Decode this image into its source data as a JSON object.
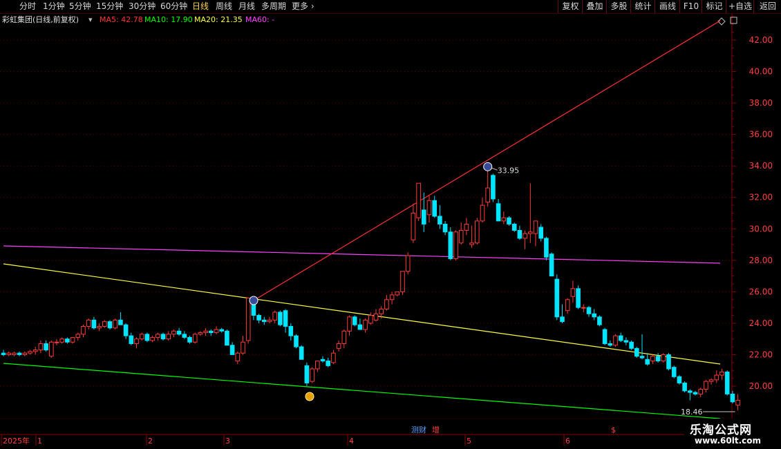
{
  "toolbar": {
    "periods": [
      "分时",
      "1分钟",
      "5分钟",
      "15分钟",
      "30分钟",
      "60分钟",
      "日线",
      "周线",
      "月线",
      "多周期",
      "更多"
    ],
    "active_period": "日线",
    "buttons": [
      "复权",
      "叠加",
      "多股",
      "统计",
      "画线",
      "F10",
      "标记",
      "+自选",
      "返回"
    ]
  },
  "legend": {
    "title": "彩虹集团(日线,前复权)",
    "ma5": "MA5: 42.78",
    "ma10": "MA10: 17.90",
    "ma20": "MA20: 21.35",
    "ma60": "MA60: -"
  },
  "colors": {
    "up": "#ff3b3b",
    "down": "#00e5ff",
    "ma5": "#ff3030",
    "ma10": "#00ff00",
    "ma20": "#ffff44",
    "ma60": "#ff40ff",
    "axis": "#8b0000",
    "grid": "#6b0000"
  },
  "chart_data": {
    "type": "candlestick",
    "ylim": [
      18.0,
      43.5
    ],
    "y_ticks": [
      20.0,
      22.0,
      24.0,
      26.0,
      28.0,
      30.0,
      32.0,
      34.0,
      36.0,
      38.0,
      40.0,
      42.0
    ],
    "x_labels": [
      "2025年",
      "1",
      "2",
      "3",
      "4",
      "5",
      "6"
    ],
    "high_label": "33.95",
    "low_label": "18.46",
    "event_markers": [
      "测财",
      "增",
      "$"
    ],
    "candles": [
      [
        22.1,
        22.3,
        21.9,
        22.0
      ],
      [
        22.0,
        22.2,
        21.9,
        22.1
      ],
      [
        22.0,
        22.2,
        21.9,
        22.1
      ],
      [
        22.1,
        22.2,
        21.9,
        22.0
      ],
      [
        22.0,
        22.2,
        21.9,
        22.1
      ],
      [
        22.1,
        22.3,
        22.0,
        22.2
      ],
      [
        22.2,
        22.5,
        22.0,
        22.3
      ],
      [
        22.3,
        22.9,
        22.1,
        22.7
      ],
      [
        22.7,
        22.9,
        22.2,
        22.3
      ],
      [
        21.9,
        22.9,
        21.8,
        22.8
      ],
      [
        22.8,
        23.0,
        22.6,
        22.8
      ],
      [
        22.8,
        23.1,
        22.7,
        23.0
      ],
      [
        23.0,
        23.1,
        22.7,
        22.8
      ],
      [
        22.8,
        23.1,
        22.7,
        23.1
      ],
      [
        23.1,
        23.4,
        22.9,
        23.3
      ],
      [
        23.3,
        23.9,
        23.1,
        23.8
      ],
      [
        23.8,
        24.3,
        23.6,
        24.2
      ],
      [
        24.2,
        24.4,
        23.6,
        23.7
      ],
      [
        23.7,
        24.0,
        23.5,
        23.8
      ],
      [
        23.8,
        24.2,
        23.7,
        24.1
      ],
      [
        24.1,
        24.2,
        23.6,
        23.7
      ],
      [
        23.7,
        24.3,
        23.6,
        24.2
      ],
      [
        24.2,
        24.7,
        23.9,
        23.9
      ],
      [
        23.9,
        24.0,
        23.0,
        23.2
      ],
      [
        23.2,
        23.4,
        22.6,
        22.7
      ],
      [
        22.7,
        23.1,
        22.4,
        23.0
      ],
      [
        23.0,
        23.4,
        22.9,
        23.3
      ],
      [
        23.3,
        23.4,
        22.8,
        22.9
      ],
      [
        22.9,
        23.2,
        22.8,
        23.1
      ],
      [
        23.1,
        23.4,
        22.9,
        23.3
      ],
      [
        23.3,
        23.4,
        22.9,
        23.0
      ],
      [
        23.0,
        23.5,
        22.9,
        23.3
      ],
      [
        23.3,
        23.6,
        23.1,
        23.5
      ],
      [
        23.5,
        23.7,
        23.2,
        23.3
      ],
      [
        23.3,
        23.5,
        23.0,
        23.1
      ],
      [
        23.1,
        23.2,
        22.7,
        22.8
      ],
      [
        22.8,
        23.4,
        22.7,
        23.3
      ],
      [
        23.3,
        23.5,
        23.2,
        23.4
      ],
      [
        23.4,
        23.7,
        23.2,
        23.5
      ],
      [
        23.5,
        23.6,
        23.2,
        23.4
      ],
      [
        23.4,
        23.8,
        23.3,
        23.6
      ],
      [
        23.6,
        23.7,
        23.4,
        23.5
      ],
      [
        23.5,
        23.6,
        22.6,
        22.6
      ],
      [
        22.6,
        22.8,
        22.0,
        22.0
      ],
      [
        21.6,
        22.2,
        21.4,
        22.1
      ],
      [
        22.1,
        23.2,
        22.0,
        22.8
      ],
      [
        22.9,
        25.6,
        22.7,
        25.6
      ],
      [
        25.3,
        25.6,
        24.2,
        24.5
      ],
      [
        24.5,
        24.6,
        24.0,
        24.2
      ],
      [
        24.2,
        24.4,
        23.9,
        24.1
      ],
      [
        24.1,
        24.4,
        24.0,
        24.2
      ],
      [
        24.2,
        24.8,
        24.0,
        24.7
      ],
      [
        24.7,
        24.8,
        23.8,
        23.9
      ],
      [
        24.8,
        24.9,
        23.4,
        23.8
      ],
      [
        23.8,
        24.0,
        22.9,
        23.2
      ],
      [
        23.2,
        23.3,
        22.4,
        22.5
      ],
      [
        22.5,
        22.6,
        21.7,
        21.7
      ],
      [
        21.3,
        21.5,
        20.0,
        20.2
      ],
      [
        20.3,
        21.2,
        20.2,
        21.1
      ],
      [
        21.1,
        21.6,
        20.9,
        21.6
      ],
      [
        21.7,
        21.9,
        21.5,
        21.6
      ],
      [
        21.6,
        21.8,
        21.2,
        21.3
      ],
      [
        21.5,
        22.3,
        21.4,
        22.1
      ],
      [
        22.4,
        22.9,
        22.2,
        22.7
      ],
      [
        22.7,
        23.6,
        22.4,
        23.5
      ],
      [
        23.5,
        24.5,
        23.2,
        24.4
      ],
      [
        24.4,
        24.5,
        23.8,
        23.9
      ],
      [
        23.9,
        24.3,
        23.6,
        23.6
      ],
      [
        23.6,
        24.3,
        23.4,
        24.2
      ],
      [
        24.0,
        24.7,
        23.9,
        24.5
      ],
      [
        24.2,
        24.9,
        24.1,
        24.6
      ],
      [
        24.6,
        25.1,
        24.3,
        24.9
      ],
      [
        24.9,
        25.8,
        24.8,
        25.5
      ],
      [
        25.5,
        26.0,
        25.2,
        25.8
      ],
      [
        25.8,
        26.0,
        25.7,
        26.0
      ],
      [
        26.0,
        27.3,
        25.8,
        27.3
      ],
      [
        27.3,
        28.5,
        27.1,
        28.3
      ],
      [
        29.3,
        31.6,
        29.1,
        31.0
      ],
      [
        30.7,
        32.9,
        30.5,
        32.9
      ],
      [
        31.2,
        32.3,
        29.8,
        30.3
      ],
      [
        30.9,
        32.1,
        30.4,
        31.8
      ],
      [
        31.8,
        32.1,
        30.7,
        30.8
      ],
      [
        30.8,
        31.5,
        30.0,
        30.3
      ],
      [
        30.3,
        30.5,
        29.6,
        29.8
      ],
      [
        29.8,
        30.1,
        28.0,
        28.1
      ],
      [
        28.1,
        29.9,
        28.0,
        29.8
      ],
      [
        29.1,
        30.4,
        29.0,
        29.9
      ],
      [
        29.9,
        30.7,
        29.6,
        30.3
      ],
      [
        29.0,
        30.2,
        28.8,
        29.1
      ],
      [
        29.1,
        30.7,
        29.0,
        30.5
      ],
      [
        30.5,
        32.0,
        30.4,
        31.5
      ],
      [
        31.7,
        33.95,
        31.4,
        32.6
      ],
      [
        33.4,
        33.5,
        31.7,
        31.9
      ],
      [
        31.6,
        31.9,
        30.5,
        30.5
      ],
      [
        30.5,
        31.1,
        30.3,
        30.7
      ],
      [
        30.7,
        30.8,
        30.2,
        30.3
      ],
      [
        30.3,
        30.4,
        29.8,
        29.9
      ],
      [
        29.9,
        30.2,
        29.3,
        29.4
      ],
      [
        29.4,
        29.9,
        28.7,
        29.7
      ],
      [
        29.7,
        32.9,
        29.1,
        29.8
      ],
      [
        29.7,
        30.5,
        28.9,
        30.5
      ],
      [
        30.1,
        30.3,
        29.2,
        29.4
      ],
      [
        29.4,
        29.5,
        28.0,
        28.2
      ],
      [
        28.4,
        28.5,
        27.0,
        27.0
      ],
      [
        26.8,
        27.1,
        24.2,
        24.4
      ],
      [
        24.4,
        25.2,
        24.0,
        24.1
      ],
      [
        24.8,
        25.6,
        24.6,
        25.5
      ],
      [
        25.7,
        26.7,
        25.3,
        26.2
      ],
      [
        26.2,
        26.4,
        24.9,
        25.0
      ],
      [
        25.0,
        25.2,
        24.7,
        25.0
      ],
      [
        25.0,
        25.1,
        24.4,
        24.6
      ],
      [
        24.6,
        24.9,
        24.2,
        24.4
      ],
      [
        24.4,
        24.5,
        23.8,
        23.9
      ],
      [
        23.6,
        23.7,
        22.6,
        22.7
      ],
      [
        22.7,
        22.9,
        22.5,
        22.6
      ],
      [
        22.6,
        23.3,
        22.5,
        23.2
      ],
      [
        23.2,
        23.4,
        22.8,
        22.9
      ],
      [
        22.9,
        23.1,
        22.6,
        22.8
      ],
      [
        22.8,
        22.9,
        22.3,
        22.4
      ],
      [
        22.4,
        22.5,
        21.8,
        21.9
      ],
      [
        21.9,
        23.3,
        21.7,
        21.8
      ],
      [
        21.7,
        22.1,
        21.3,
        21.4
      ],
      [
        21.6,
        22.0,
        21.4,
        21.9
      ],
      [
        21.9,
        22.1,
        21.5,
        21.6
      ],
      [
        21.6,
        22.1,
        21.5,
        22.0
      ],
      [
        22.0,
        22.1,
        21.0,
        21.1
      ],
      [
        21.2,
        21.3,
        20.5,
        20.6
      ],
      [
        20.6,
        20.7,
        20.1,
        20.2
      ],
      [
        20.2,
        20.3,
        19.6,
        19.7
      ],
      [
        19.7,
        19.8,
        19.1,
        19.6
      ],
      [
        19.6,
        19.7,
        19.4,
        19.5
      ],
      [
        19.5,
        19.9,
        19.3,
        19.8
      ],
      [
        19.8,
        20.4,
        19.6,
        20.3
      ],
      [
        20.3,
        20.5,
        20.1,
        20.4
      ],
      [
        20.4,
        21.0,
        20.2,
        20.7
      ],
      [
        20.7,
        21.1,
        20.4,
        20.9
      ],
      [
        20.9,
        21.0,
        19.4,
        19.5
      ],
      [
        19.5,
        19.7,
        18.9,
        19.0
      ],
      [
        18.8,
        19.5,
        18.46,
        19.1
      ]
    ]
  }
}
